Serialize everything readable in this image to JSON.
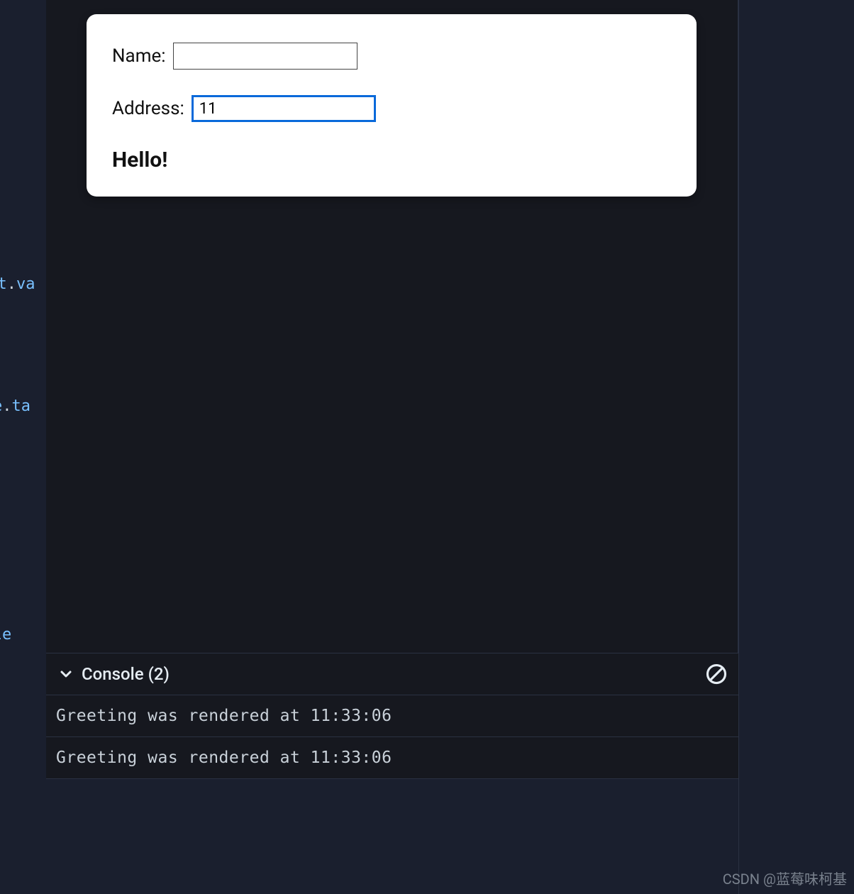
{
  "code_fragments": {
    "frag1_a": "get",
    "frag1_b": ".",
    "frag1_c": "va",
    "frag2_a": "e",
    "frag2_b": ".",
    "frag2_c": "ta",
    "frag3_a": "ocale"
  },
  "form": {
    "name_label": "Name:",
    "name_value": "",
    "address_label": "Address:",
    "address_value": "11"
  },
  "greeting": "Hello!",
  "console": {
    "title": "Console",
    "count": "(2)",
    "rows": [
      "Greeting was rendered at 11:33:06",
      "Greeting was rendered at 11:33:06"
    ]
  },
  "watermark": "CSDN @蓝莓味柯基"
}
